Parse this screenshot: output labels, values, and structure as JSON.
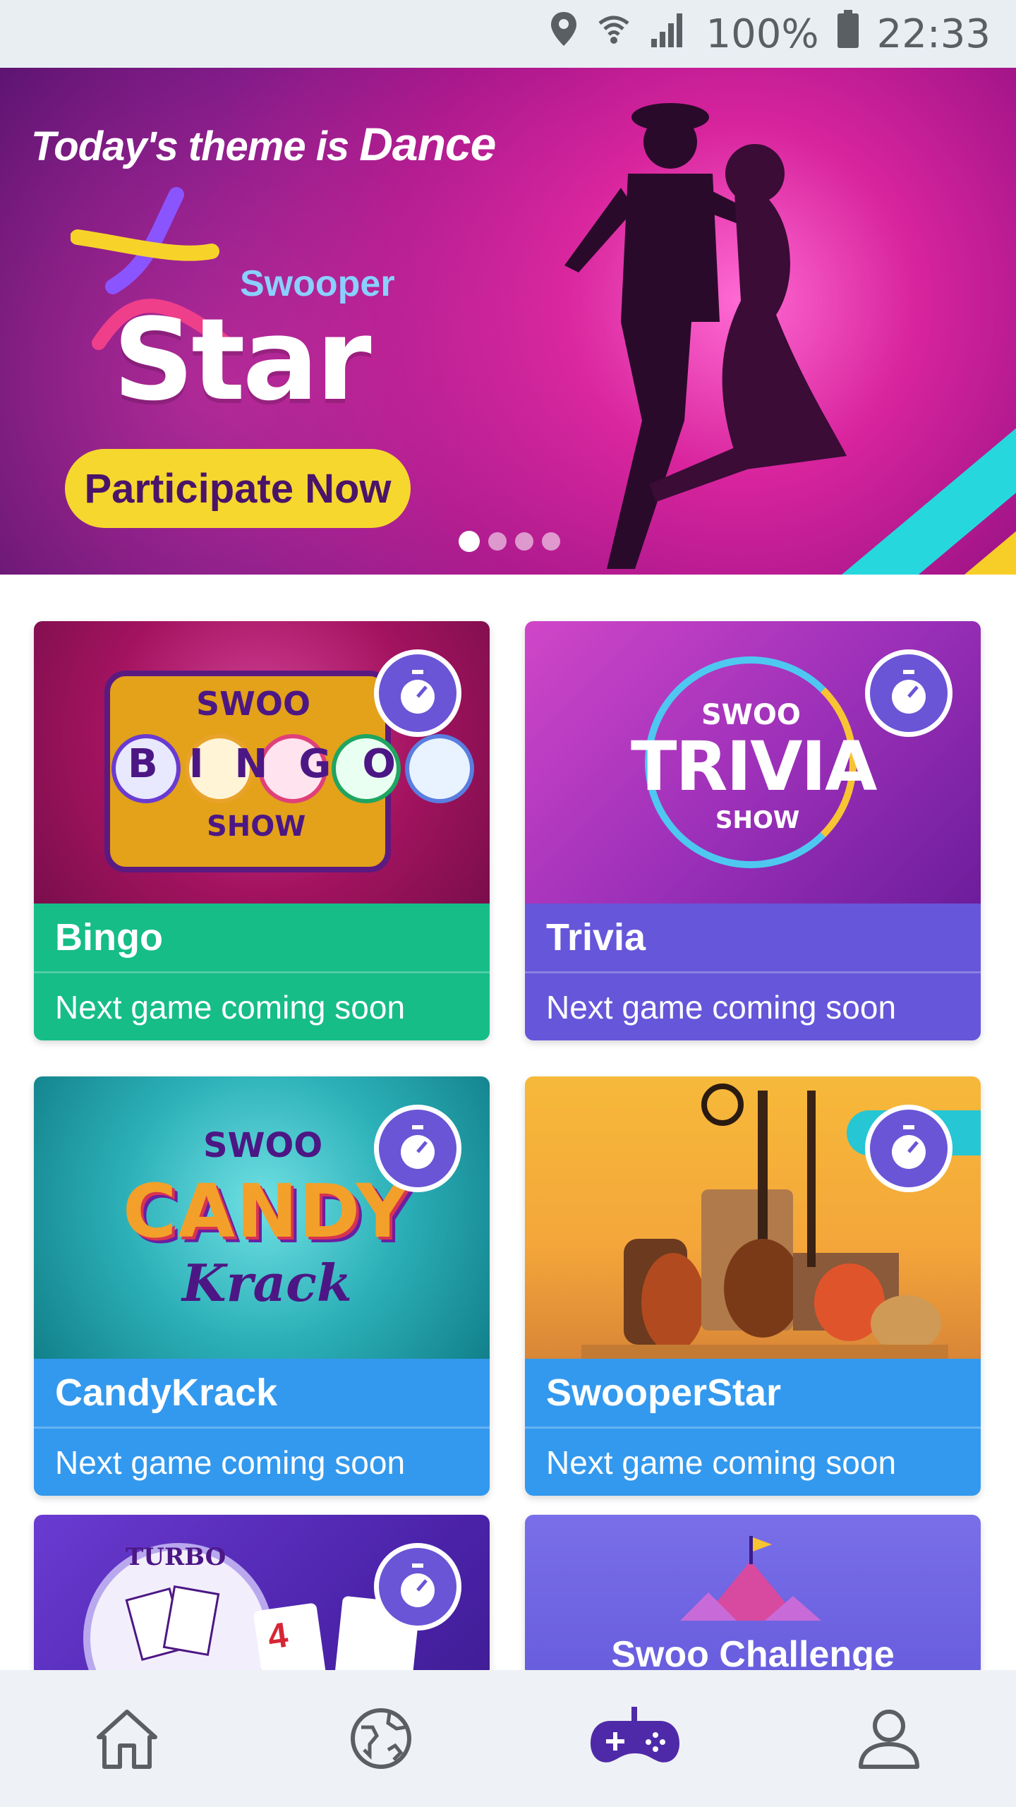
{
  "status_bar": {
    "battery": "100%",
    "time": "22:33",
    "icons": [
      "location-icon",
      "wifi-icon",
      "signal-icon",
      "battery-icon"
    ]
  },
  "banner": {
    "theme_prefix": "Today's theme is",
    "theme_word": "Dance",
    "brand_small": "Swooper",
    "brand_big": "Star",
    "cta_label": "Participate Now",
    "page_dots": 4,
    "active_dot": 1
  },
  "games": [
    {
      "title": "Bingo",
      "status": "Next game coming soon",
      "logo_top": "SWOO",
      "logo_main": "BINGO",
      "logo_bottom": "SHOW",
      "color": "#16bd87"
    },
    {
      "title": "Trivia",
      "status": "Next game coming soon",
      "logo_top": "SWOO",
      "logo_main": "TRIVIA",
      "logo_bottom": "SHOW",
      "color": "#6656d9"
    },
    {
      "title": "CandyKrack",
      "status": "Next game coming soon",
      "logo_top": "SWOO",
      "logo_main": "CANDY",
      "logo_bottom": "Krack",
      "color": "#3399ee"
    },
    {
      "title": "SwooperStar",
      "status": "Next game coming soon",
      "color": "#3399ee"
    }
  ],
  "partial_cards": {
    "turbo_logo": "TURBO",
    "card_digit": "4",
    "challenge_label": "Swoo Challenge"
  },
  "nav": {
    "items": [
      "home-icon",
      "globe-icon",
      "gamepad-icon",
      "profile-icon"
    ],
    "active": "gamepad-icon",
    "active_color": "#4f2aa8"
  }
}
